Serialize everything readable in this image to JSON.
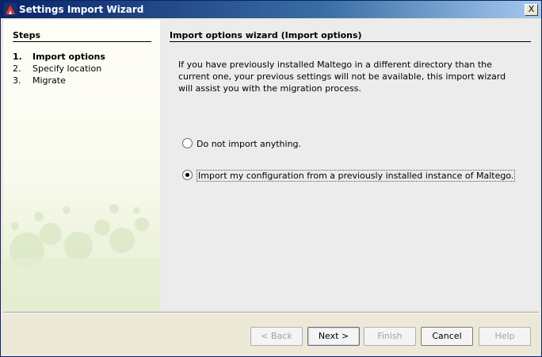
{
  "window": {
    "title": "Settings Import Wizard",
    "close_label": "X"
  },
  "steps": {
    "heading": "Steps",
    "items": [
      {
        "num": "1.",
        "label": "Import options"
      },
      {
        "num": "2.",
        "label": "Specify location"
      },
      {
        "num": "3.",
        "label": "Migrate"
      }
    ]
  },
  "panel": {
    "heading": "Import options wizard (Import options)",
    "description": "If you have previously installed Maltego in a different directory than the current one, your previous settings will not be available, this import wizard will assist you with the migration process.",
    "options": [
      {
        "label": "Do not import anything.",
        "selected": false
      },
      {
        "label": "Import my configuration from a previously installed instance of Maltego.",
        "selected": true
      }
    ]
  },
  "buttons": {
    "back": "< Back",
    "next": "Next >",
    "finish": "Finish",
    "cancel": "Cancel",
    "help": "Help"
  }
}
